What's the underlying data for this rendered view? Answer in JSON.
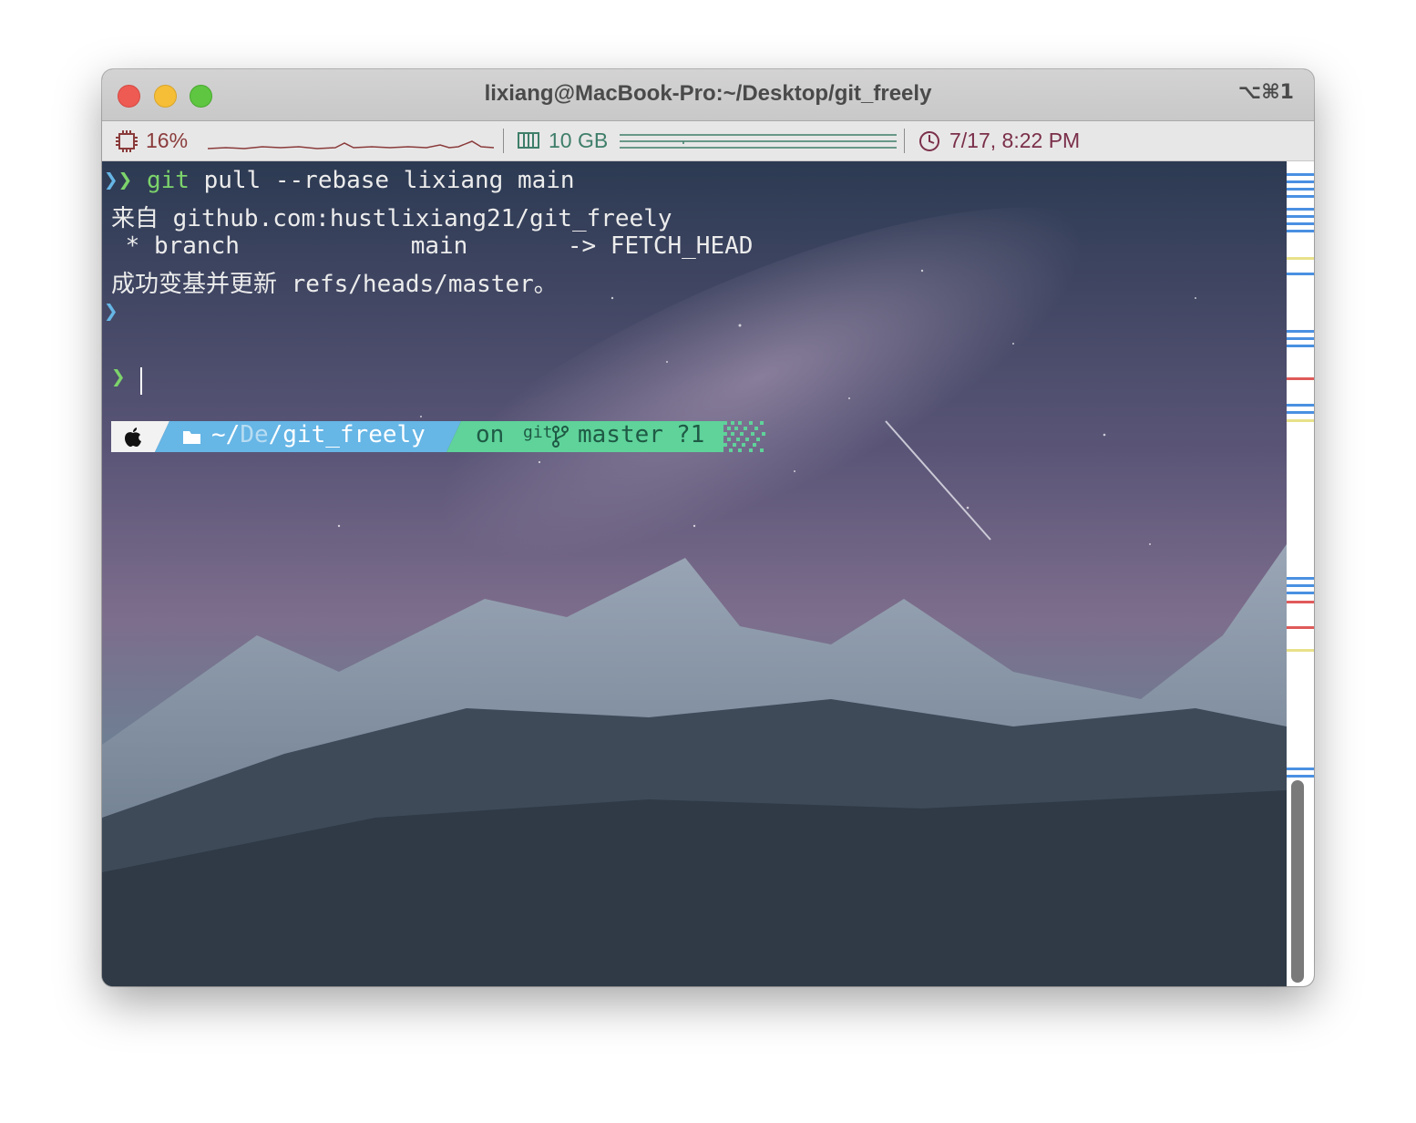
{
  "window": {
    "title": "lixiang@MacBook-Pro:~/Desktop/git_freely",
    "shortcut": "⌥⌘1"
  },
  "status_bar": {
    "cpu": "16%",
    "memory": "10 GB",
    "datetime": "7/17, 8:22 PM",
    "colors": {
      "cpu": "#8a3b3b",
      "memory": "#3e7e6a",
      "clock": "#7a2f4a"
    }
  },
  "terminal": {
    "prompt_symbol": "❯",
    "lines": [
      {
        "cmd": "git",
        "args": " pull --rebase lixiang main"
      },
      {
        "text": "来自 github.com:hustlixiang21/git_freely"
      },
      {
        "text": " * branch            main       -> FETCH_HEAD"
      },
      {
        "text": "成功变基并更新 refs/heads/master。"
      }
    ],
    "powerline": {
      "os_icon": "apple-icon",
      "dir_prefix": "~/",
      "dir_dim": "De",
      "dir_main": "/git_freely",
      "on": "on",
      "git_label": "git",
      "branch": "master",
      "status": "?1",
      "colors": {
        "os_bg": "#f2f2f2",
        "dir_bg": "#66b6e6",
        "git_bg": "#5fd39a",
        "green_prompt": "#7cd36b"
      }
    }
  },
  "icons": {
    "cpu": "cpu-chip-icon",
    "memory": "memory-icon",
    "clock": "clock-icon",
    "folder": "folder-icon",
    "branch": "git-branch-icon"
  }
}
